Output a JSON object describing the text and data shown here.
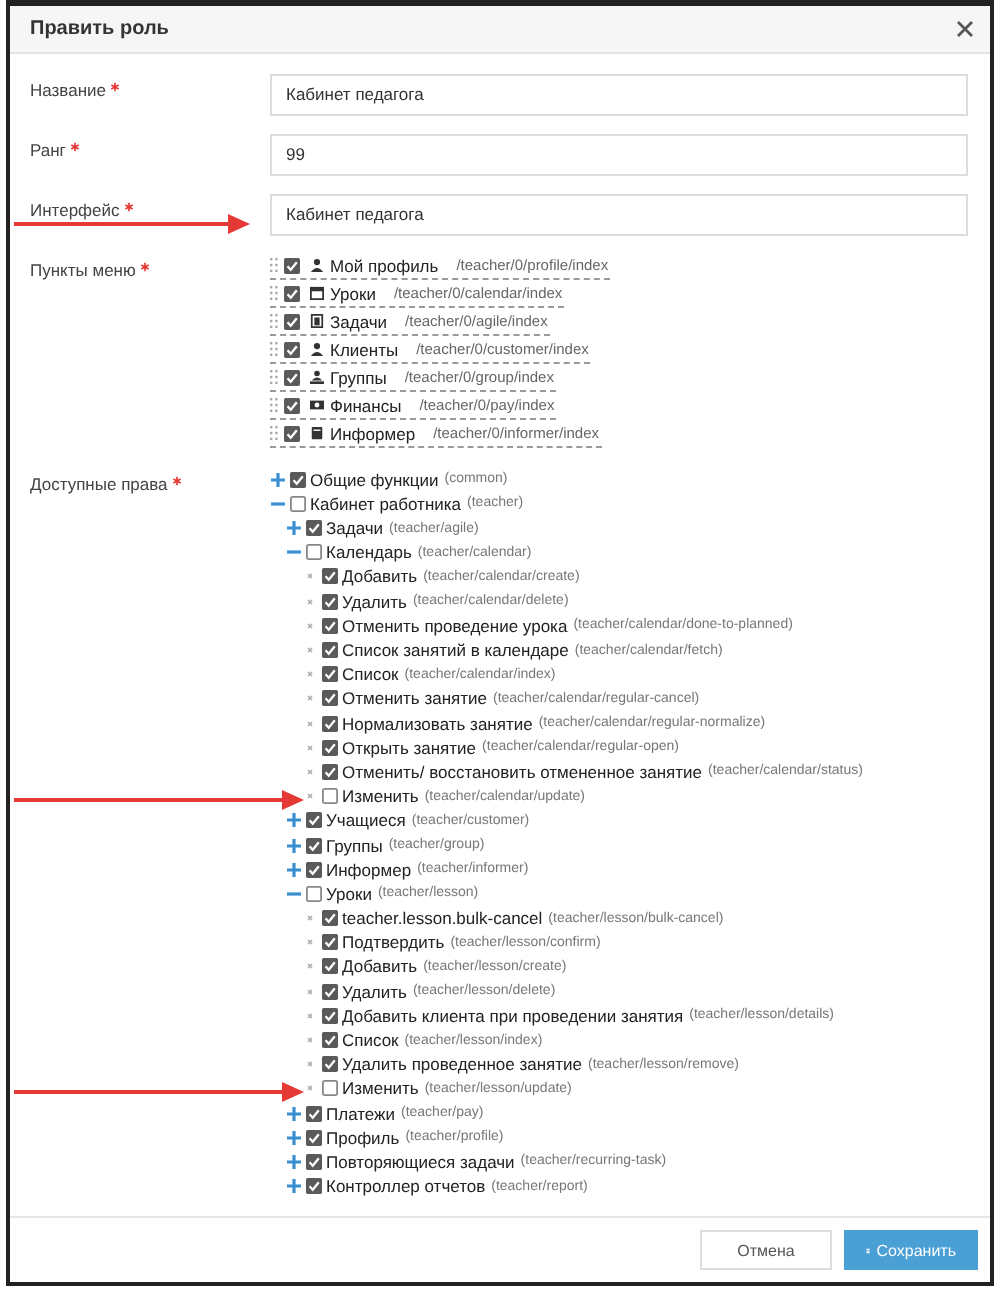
{
  "dialog": {
    "title": "Править роль"
  },
  "fields": [
    {
      "label": "Название",
      "required": true,
      "value": "Кабинет педагога",
      "marked": false
    },
    {
      "label": "Ранг",
      "required": true,
      "value": "99",
      "marked": false
    },
    {
      "label": "Интерфейс",
      "required": true,
      "value": "Кабинет педагога",
      "marked": true
    }
  ],
  "menu": {
    "label": "Пункты меню",
    "required": true,
    "items": [
      {
        "label": "Мой профиль",
        "path": "/teacher/0/profile/index",
        "checked": true,
        "kind": "user"
      },
      {
        "label": "Уроки",
        "path": "/teacher/0/calendar/index",
        "checked": true,
        "kind": "calendar"
      },
      {
        "label": "Задачи",
        "path": "/teacher/0/agile/index",
        "checked": true,
        "kind": "clipboard"
      },
      {
        "label": "Клиенты",
        "path": "/teacher/0/customer/index",
        "checked": true,
        "kind": "user"
      },
      {
        "label": "Группы",
        "path": "/teacher/0/group/index",
        "checked": true,
        "kind": "users"
      },
      {
        "label": "Финансы",
        "path": "/teacher/0/pay/index",
        "checked": true,
        "kind": "money"
      },
      {
        "label": "Информер",
        "path": "/teacher/0/informer/index",
        "checked": true,
        "kind": "book"
      }
    ]
  },
  "rights": {
    "label": "Доступные права",
    "required": true,
    "tree": [
      {
        "kind": "branch",
        "name": "Общие функции",
        "code": "(common)",
        "checked": true,
        "expanded": false,
        "marked": false
      },
      {
        "kind": "branch",
        "name": "Кабинет работника",
        "code": "(teacher)",
        "checked": false,
        "expanded": true,
        "marked": false,
        "children": [
          {
            "kind": "branch",
            "name": "Задачи",
            "code": "(teacher/agile)",
            "checked": true,
            "expanded": false,
            "marked": false
          },
          {
            "kind": "branch",
            "name": "Календарь",
            "code": "(teacher/calendar)",
            "checked": false,
            "expanded": true,
            "marked": false,
            "children": [
              {
                "kind": "leaf",
                "name": "Добавить",
                "code": "(teacher/calendar/create)",
                "checked": true,
                "marked": false
              },
              {
                "kind": "leaf",
                "name": "Удалить",
                "code": "(teacher/calendar/delete)",
                "checked": true,
                "marked": false
              },
              {
                "kind": "leaf",
                "name": "Отменить проведение урока",
                "code": "(teacher/calendar/done-to-planned)",
                "checked": true,
                "marked": false
              },
              {
                "kind": "leaf",
                "name": "Список занятий в календаре",
                "code": "(teacher/calendar/fetch)",
                "checked": true,
                "marked": false
              },
              {
                "kind": "leaf",
                "name": "Список",
                "code": "(teacher/calendar/index)",
                "checked": true,
                "marked": false
              },
              {
                "kind": "leaf",
                "name": "Отменить занятие",
                "code": "(teacher/calendar/regular-cancel)",
                "checked": true,
                "marked": false
              },
              {
                "kind": "leaf",
                "name": "Нормализовать занятие",
                "code": "(teacher/calendar/regular-normalize)",
                "checked": true,
                "marked": false
              },
              {
                "kind": "leaf",
                "name": "Открыть занятие",
                "code": "(teacher/calendar/regular-open)",
                "checked": true,
                "marked": false
              },
              {
                "kind": "leaf",
                "name": "Отменить/ восстановить отмененное занятие",
                "code": "(teacher/calendar/status)",
                "checked": true,
                "marked": false
              },
              {
                "kind": "leaf",
                "name": "Изменить",
                "code": "(teacher/calendar/update)",
                "checked": false,
                "marked": true
              }
            ]
          },
          {
            "kind": "branch",
            "name": "Учащиеся",
            "code": "(teacher/customer)",
            "checked": true,
            "expanded": false,
            "marked": false
          },
          {
            "kind": "branch",
            "name": "Группы",
            "code": "(teacher/group)",
            "checked": true,
            "expanded": false,
            "marked": false
          },
          {
            "kind": "branch",
            "name": "Информер",
            "code": "(teacher/informer)",
            "checked": true,
            "expanded": false,
            "marked": false
          },
          {
            "kind": "branch",
            "name": "Уроки",
            "code": "(teacher/lesson)",
            "checked": false,
            "expanded": true,
            "marked": false,
            "children": [
              {
                "kind": "leaf",
                "name": "teacher.lesson.bulk-cancel",
                "code": "(teacher/lesson/bulk-cancel)",
                "checked": true,
                "marked": false
              },
              {
                "kind": "leaf",
                "name": "Подтвердить",
                "code": "(teacher/lesson/confirm)",
                "checked": true,
                "marked": false
              },
              {
                "kind": "leaf",
                "name": "Добавить",
                "code": "(teacher/lesson/create)",
                "checked": true,
                "marked": false
              },
              {
                "kind": "leaf",
                "name": "Удалить",
                "code": "(teacher/lesson/delete)",
                "checked": true,
                "marked": false
              },
              {
                "kind": "leaf",
                "name": "Добавить клиента при проведении занятия",
                "code": "(teacher/lesson/details)",
                "checked": true,
                "marked": false
              },
              {
                "kind": "leaf",
                "name": "Список",
                "code": "(teacher/lesson/index)",
                "checked": true,
                "marked": false
              },
              {
                "kind": "leaf",
                "name": "Удалить проведенное занятие",
                "code": "(teacher/lesson/remove)",
                "checked": true,
                "marked": false
              },
              {
                "kind": "leaf",
                "name": "Изменить",
                "code": "(teacher/lesson/update)",
                "checked": false,
                "marked": true
              }
            ]
          },
          {
            "kind": "branch",
            "name": "Платежи",
            "code": "(teacher/pay)",
            "checked": true,
            "expanded": false,
            "marked": false
          },
          {
            "kind": "branch",
            "name": "Профиль",
            "code": "(teacher/profile)",
            "checked": true,
            "expanded": false,
            "marked": false
          },
          {
            "kind": "branch",
            "name": "Повторяющиеся задачи",
            "code": "(teacher/recurring-task)",
            "checked": true,
            "expanded": false,
            "marked": false
          },
          {
            "kind": "branch",
            "name": "Контроллер отчетов",
            "code": "(teacher/report)",
            "checked": true,
            "expanded": false,
            "marked": false
          }
        ]
      }
    ]
  },
  "buttons": [
    {
      "label": "Отмена",
      "kind": "default"
    },
    {
      "label": "Сохранить",
      "kind": "primary"
    }
  ]
}
